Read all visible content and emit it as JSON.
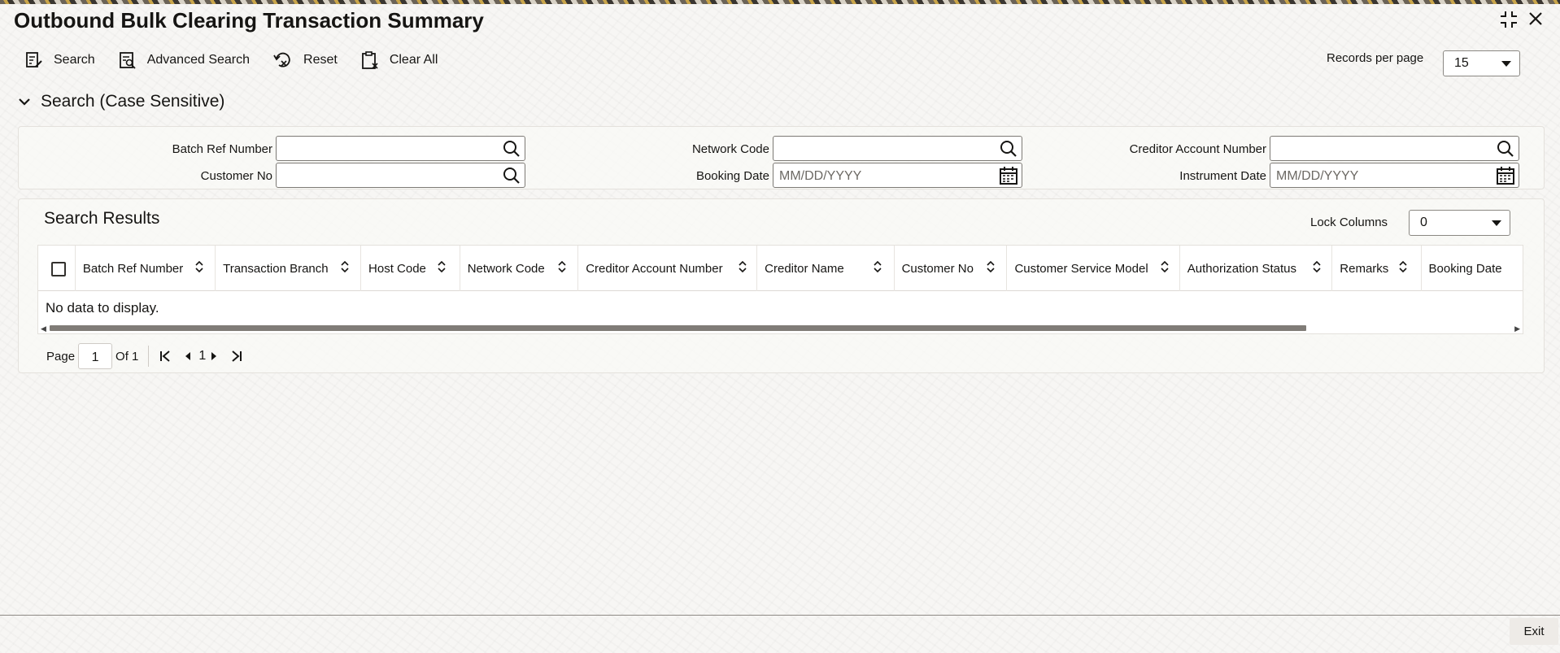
{
  "window": {
    "title": "Outbound Bulk Clearing Transaction Summary",
    "collapse_icon": "collapse-icon",
    "close_icon": "close-icon"
  },
  "toolbar": {
    "search_label": "Search",
    "advanced_search_label": "Advanced Search",
    "reset_label": "Reset",
    "clear_all_label": "Clear All"
  },
  "records_per_page": {
    "label": "Records per page",
    "value": "15"
  },
  "search_section": {
    "title": "Search (Case Sensitive)",
    "fields": {
      "batch_ref_number": {
        "label": "Batch Ref Number",
        "value": ""
      },
      "customer_no": {
        "label": "Customer No",
        "value": ""
      },
      "network_code": {
        "label": "Network Code",
        "value": ""
      },
      "booking_date": {
        "label": "Booking Date",
        "placeholder": "MM/DD/YYYY"
      },
      "creditor_account_number": {
        "label": "Creditor Account Number",
        "value": ""
      },
      "instrument_date": {
        "label": "Instrument Date",
        "placeholder": "MM/DD/YYYY"
      }
    }
  },
  "results": {
    "title": "Search Results",
    "lock_columns_label": "Lock Columns",
    "lock_columns_value": "0",
    "columns": [
      "Batch Ref Number",
      "Transaction Branch",
      "Host Code",
      "Network Code",
      "Creditor Account Number",
      "Creditor Name",
      "Customer No",
      "Customer Service Model",
      "Authorization Status",
      "Remarks",
      "Booking Date"
    ],
    "empty_message": "No data to display."
  },
  "pagination": {
    "page_label": "Page",
    "current_page": "1",
    "of_label": "Of 1",
    "page_indicator": "1"
  },
  "footer": {
    "exit_label": "Exit"
  },
  "colors": {
    "background": "#f7f6f4",
    "text": "#161513",
    "border": "#7d7a75"
  }
}
